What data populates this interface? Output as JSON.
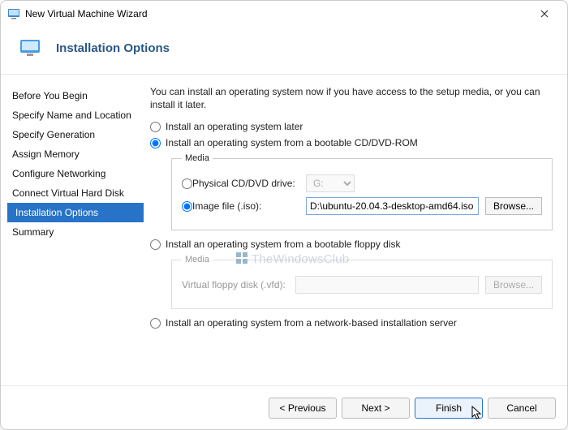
{
  "title": "New Virtual Machine Wizard",
  "header": "Installation Options",
  "sidebar": {
    "items": [
      {
        "label": "Before You Begin"
      },
      {
        "label": "Specify Name and Location"
      },
      {
        "label": "Specify Generation"
      },
      {
        "label": "Assign Memory"
      },
      {
        "label": "Configure Networking"
      },
      {
        "label": "Connect Virtual Hard Disk"
      },
      {
        "label": "Installation Options"
      },
      {
        "label": "Summary"
      }
    ]
  },
  "content": {
    "intro": "You can install an operating system now if you have access to the setup media, or you can install it later.",
    "opt_later": "Install an operating system later",
    "opt_cd": "Install an operating system from a bootable CD/DVD-ROM",
    "media_legend": "Media",
    "opt_phys_drive": "Physical CD/DVD drive:",
    "drive_value": "G:",
    "opt_image_file": "Image file (.iso):",
    "image_path": "D:\\ubuntu-20.04.3-desktop-amd64.iso",
    "browse": "Browse...",
    "opt_floppy": "Install an operating system from a bootable floppy disk",
    "floppy_label": "Virtual floppy disk (.vfd):",
    "opt_network": "Install an operating system from a network-based installation server"
  },
  "footer": {
    "previous": "< Previous",
    "next": "Next >",
    "finish": "Finish",
    "cancel": "Cancel"
  },
  "watermark": "TheWindowsClub"
}
